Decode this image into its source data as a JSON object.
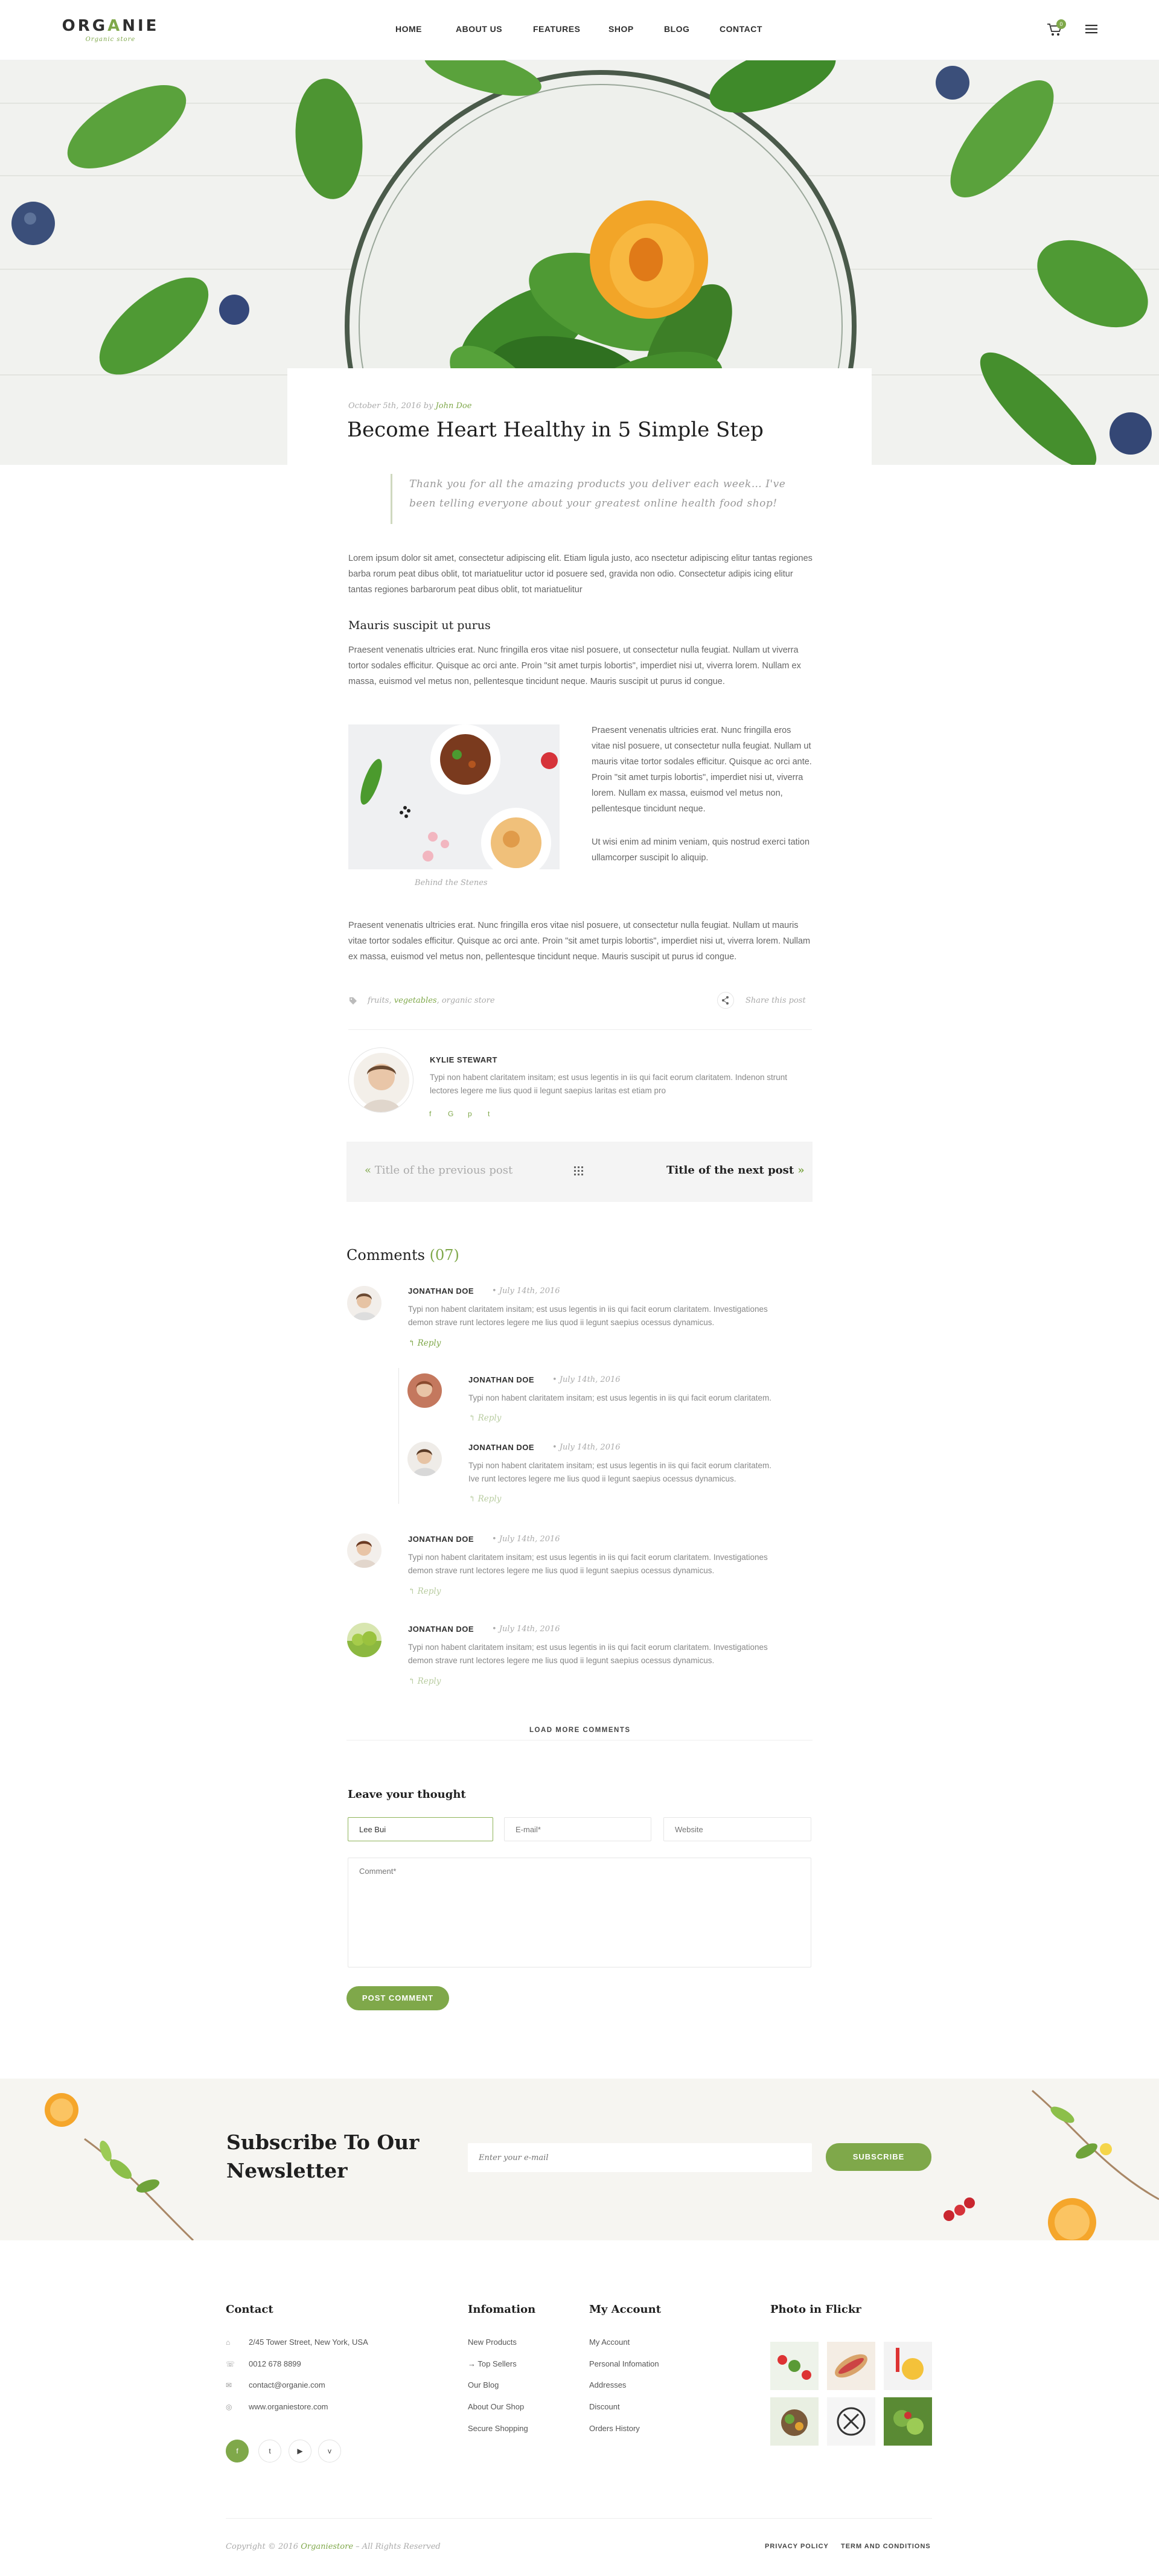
{
  "header": {
    "logo_text_a": "ORG",
    "logo_text_b": "A",
    "logo_text_c": "NIE",
    "logo_tagline": "Organic store",
    "nav": [
      "HOME",
      "ABOUT US",
      "FEATURES",
      "SHOP",
      "BLOG",
      "CONTACT"
    ],
    "cart_count": "0"
  },
  "article": {
    "date": "October 5th, 2016",
    "by": "by",
    "author": "John Doe",
    "title": "Become Heart Healthy in 5 Simple Step",
    "quote_line1": "Thank you for all the amazing products you deliver each week… I've",
    "quote_line2": "been telling everyone about your greatest online health food shop!",
    "intro": "Lorem ipsum dolor sit amet, consectetur adipiscing elit. Etiam ligula justo, aco nsectetur adipiscing elitur tantas regiones barba rorum peat dibus oblit, tot mariatuelitur uctor id posuere sed, gravida non odio. Consectetur adipis icing elitur tantas regiones barbarorum peat dibus oblit, tot mariatuelitur",
    "subheading": "Mauris suscipit ut purus",
    "para2": "Praesent venenatis ultricies erat. Nunc fringilla eros vitae nisl posuere, ut consectetur nulla feugiat. Nullam ut viverra tortor sodales efficitur. Quisque ac orci ante. Proin \"sit amet turpis lobortis\", imperdiet nisi ut, viverra lorem. Nullam ex massa, euismod vel metus non, pellentesque tincidunt neque. Mauris suscipit ut purus id congue.",
    "image_caption": "Behind the Stenes",
    "side_para1": "Praesent venenatis ultricies erat. Nunc fringilla eros vitae nisl posuere, ut consectetur nulla feugiat. Nullam ut mauris vitae tortor sodales efficitur. Quisque ac orci ante. Proin \"sit amet turpis lobortis\", imperdiet nisi ut, viverra lorem. Nullam ex massa, euismod vel metus non, pellentesque tincidunt neque.",
    "side_para2": "Ut wisi enim ad minim veniam, quis nostrud exerci tation ullamcorper suscipit lo aliquip.",
    "para3": "Praesent venenatis ultricies erat. Nunc fringilla eros vitae nisl posuere, ut consectetur nulla feugiat. Nullam ut mauris vitae tortor sodales efficitur. Quisque ac orci ante. Proin \"sit amet turpis lobortis\", imperdiet nisi ut, viverra lorem. Nullam ex massa, euismod vel metus non, pellentesque tincidunt neque. Mauris suscipit ut purus id congue.",
    "tags_a": "fruits, ",
    "tags_b": "vegetables",
    "tags_c": ", organic store",
    "share": "Share this post"
  },
  "author_box": {
    "name": "KYLIE STEWART",
    "bio": "Typi non habent claritatem insitam; est usus legentis in iis qui facit eorum claritatem. Indenon strunt lectores legere me lius quod ii legunt saepius laritas est etiam pro",
    "socials": [
      "f",
      "G",
      "p",
      "t"
    ]
  },
  "post_nav": {
    "prev": "Title of the previous post",
    "next": "Title of the next post"
  },
  "comments": {
    "heading": "Comments",
    "count": "(07)",
    "items": [
      {
        "name": "JONATHAN DOE",
        "date": "July 14th, 2016",
        "text1": "Typi non habent claritatem insitam; est usus legentis in iis qui facit eorum claritatem. Investigationes",
        "text2": "demon strave runt lectores legere me lius quod ii legunt saepius ocessus dynamicus.",
        "reply": "Reply"
      },
      {
        "name": "JONATHAN DOE",
        "date": "July 14th, 2016",
        "text1": "Typi non habent claritatem insitam; est usus legentis in iis qui facit eorum claritatem.",
        "text2": "",
        "reply": "Reply"
      },
      {
        "name": "JONATHAN DOE",
        "date": "July 14th, 2016",
        "text1": "Typi non habent claritatem insitam; est usus legentis in iis qui facit eorum claritatem.",
        "text2": "Ive runt lectores legere me lius quod ii legunt saepius ocessus dynamicus.",
        "reply": "Reply"
      },
      {
        "name": "JONATHAN DOE",
        "date": "July 14th, 2016",
        "text1": "Typi non habent claritatem insitam; est usus legentis in iis qui facit eorum claritatem. Investigationes",
        "text2": "demon strave runt lectores legere me lius quod ii legunt saepius ocessus dynamicus.",
        "reply": "Reply"
      },
      {
        "name": "JONATHAN DOE",
        "date": "July 14th, 2016",
        "text1": "Typi non habent claritatem insitam; est usus legentis in iis qui facit eorum claritatem. Investigationes",
        "text2": "demon strave runt lectores legere me lius quod ii legunt saepius ocessus dynamicus.",
        "reply": "Reply"
      }
    ],
    "load_more": "LOAD MORE COMMENTS"
  },
  "form": {
    "heading": "Leave your thought",
    "name_value": "Lee Bui",
    "email_placeholder": "E-mail*",
    "website_placeholder": "Website",
    "comment_placeholder": "Comment*",
    "submit": "POST COMMENT"
  },
  "subscribe": {
    "title_line1": "Subscribe To Our",
    "title_line2": "Newsletter",
    "placeholder": "Enter your e-mail",
    "button": "SUBSCRIBE"
  },
  "footer": {
    "contact_head": "Contact",
    "address": "2/45 Tower Street, New York, USA",
    "phone": "0012 678 8899",
    "email": "contact@organie.com",
    "web": "www.organiestore.com",
    "socials": [
      "f",
      "t",
      "▶",
      "v"
    ],
    "info_head": "Infomation",
    "info_links": [
      "New Products",
      "Top Sellers",
      "Our Blog",
      "About Our Shop",
      "Secure Shopping"
    ],
    "account_head": "My Account",
    "account_links": [
      "My Account",
      "Personal Infomation",
      "Addresses",
      "Discount",
      "Orders History"
    ],
    "flickr_head": "Photo in Flickr",
    "copyright_a": "Copyright © 2016 ",
    "copyright_b": "Organiestore",
    "copyright_c": " – All Rights Reserved",
    "privacy": "PRIVACY POLICY",
    "terms": "TERM AND CONDITIONS"
  },
  "colors": {
    "accent": "#7fa84a",
    "text": "#555555",
    "heading": "#1f1f1f"
  }
}
